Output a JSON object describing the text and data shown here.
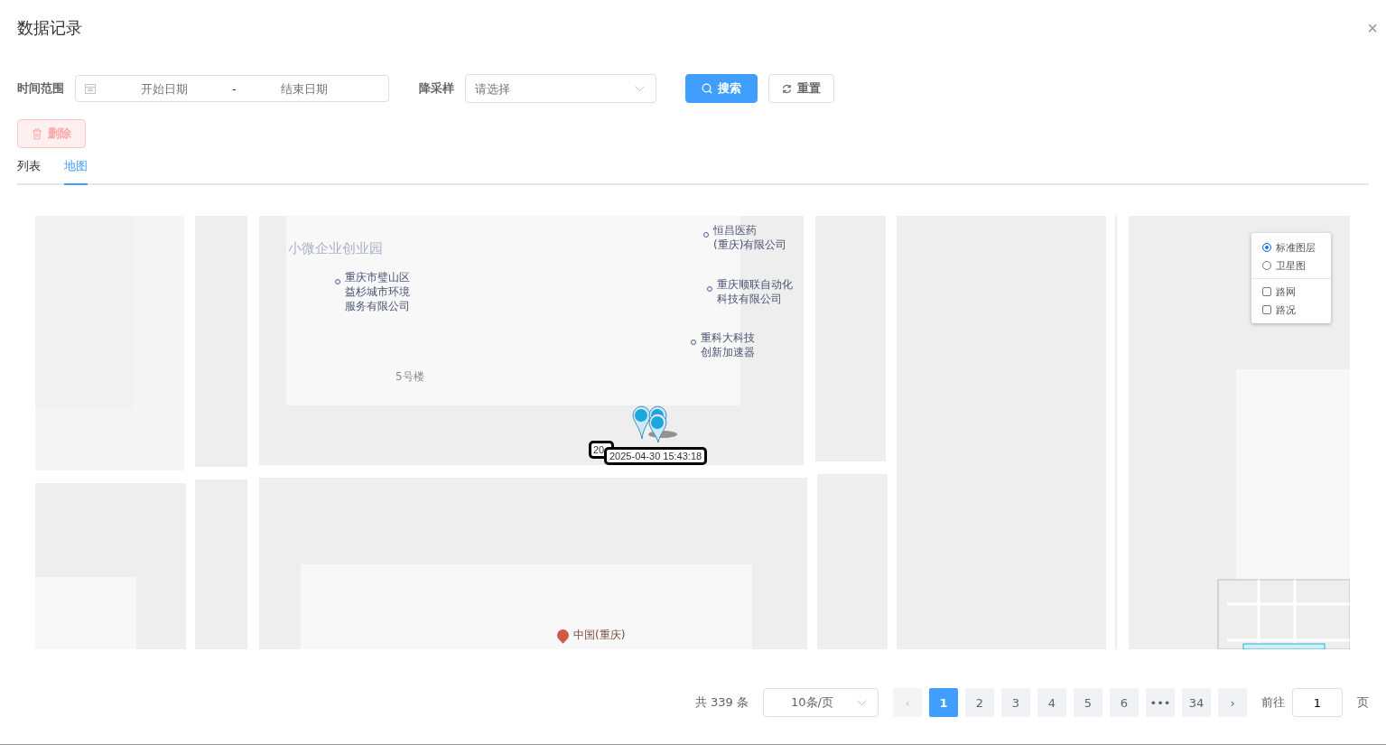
{
  "dialog": {
    "title": "数据记录",
    "close": "×"
  },
  "filters": {
    "time_label": "时间范围",
    "start_placeholder": "开始日期",
    "separator": "-",
    "end_placeholder": "结束日期",
    "sample_label": "降采样",
    "sample_placeholder": "请选择",
    "search_button": "搜索",
    "reset_button": "重置"
  },
  "delete_button": {
    "label": "删除",
    "disabled": true
  },
  "tabs": [
    {
      "label": "列表",
      "selected": false
    },
    {
      "label": "地图",
      "selected": true
    }
  ],
  "map": {
    "labels": [
      {
        "kind": "area",
        "lines": [
          "小微企业创业园"
        ]
      },
      {
        "kind": "poi",
        "lines": [
          "重庆市璧山区",
          "益杉城市环境",
          "服务有限公司"
        ]
      },
      {
        "kind": "poi",
        "lines": [
          "恒昌医药",
          "(重庆)有限公司"
        ]
      },
      {
        "kind": "poi",
        "lines": [
          "重庆顺联自动化",
          "科技有限公司"
        ]
      },
      {
        "kind": "poi",
        "lines": [
          "重科大科技",
          "创新加速器"
        ]
      },
      {
        "kind": "building",
        "lines": [
          "5号楼"
        ]
      },
      {
        "kind": "museum",
        "lines": [
          "中国(重庆)"
        ]
      }
    ],
    "tooltips": [
      {
        "text": "20"
      },
      {
        "text": "2025-04-30 15:43:18"
      }
    ],
    "layers": [
      {
        "label": "标准图层",
        "selected": true
      },
      {
        "label": "卫星图",
        "selected": false
      }
    ],
    "overlays": [
      {
        "label": "路网",
        "checked": false
      },
      {
        "label": "路况",
        "checked": false
      }
    ]
  },
  "pagination": {
    "total": "共 339 条",
    "page_size": "10条/页",
    "prev": "‹",
    "next": "›",
    "pages": [
      {
        "label": "1",
        "selected": true
      },
      {
        "label": "2",
        "selected": false
      },
      {
        "label": "3",
        "selected": false
      },
      {
        "label": "4",
        "selected": false
      },
      {
        "label": "5",
        "selected": false
      },
      {
        "label": "6",
        "selected": false
      },
      {
        "label": "•••",
        "selected": false
      },
      {
        "label": "34",
        "selected": false
      }
    ],
    "goto_label": "前往",
    "goto_value": "1",
    "page_unit": "页"
  }
}
